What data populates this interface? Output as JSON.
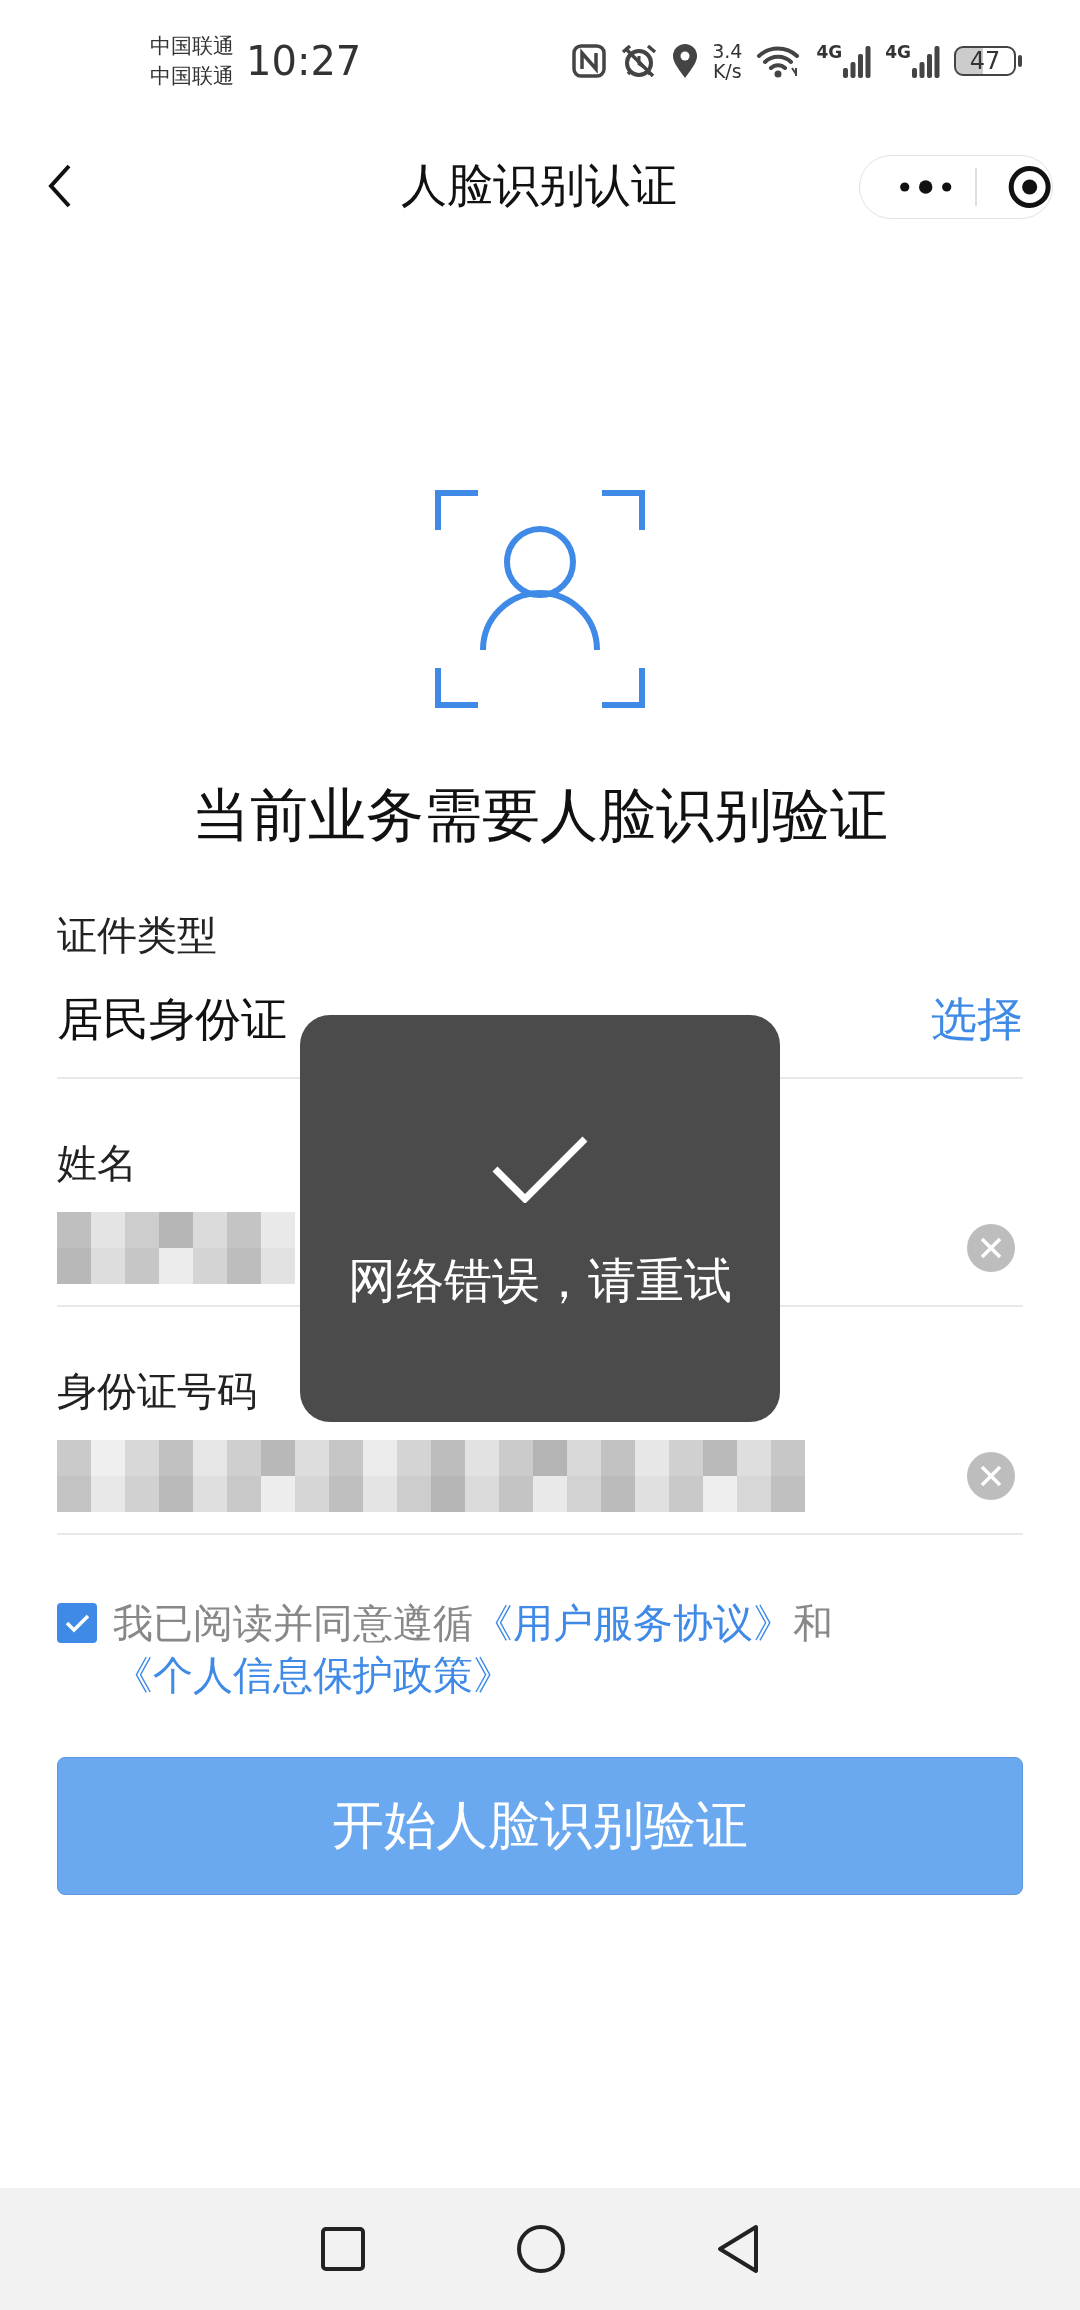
{
  "status_bar": {
    "carriers": [
      "中国联通",
      "中国联通"
    ],
    "time": "10:27",
    "speed": [
      "3.4",
      "K/s"
    ],
    "signals": [
      "4G",
      "4G"
    ],
    "battery": "47"
  },
  "nav_bar": {
    "title": "人脸识别认证"
  },
  "heading": "当前业务需要人脸识别验证",
  "fields": [
    {
      "kind": "select",
      "label": "证件类型",
      "value": "居民身份证",
      "action": "选择"
    },
    {
      "kind": "obscured",
      "label": "姓名"
    },
    {
      "kind": "obscured",
      "label": "身份证号码"
    }
  ],
  "agreement": {
    "checked": true,
    "parts": [
      {
        "kind": "text",
        "text": "我已阅读并同意遵循"
      },
      {
        "kind": "link",
        "text": "《用户服务协议》"
      },
      {
        "kind": "text",
        "text": "和"
      },
      {
        "kind": "link",
        "text": "《个人信息保护政策》"
      }
    ]
  },
  "start_button": {
    "label": "开始人脸识别验证"
  },
  "toast": {
    "text": "网络错误，请重试"
  }
}
